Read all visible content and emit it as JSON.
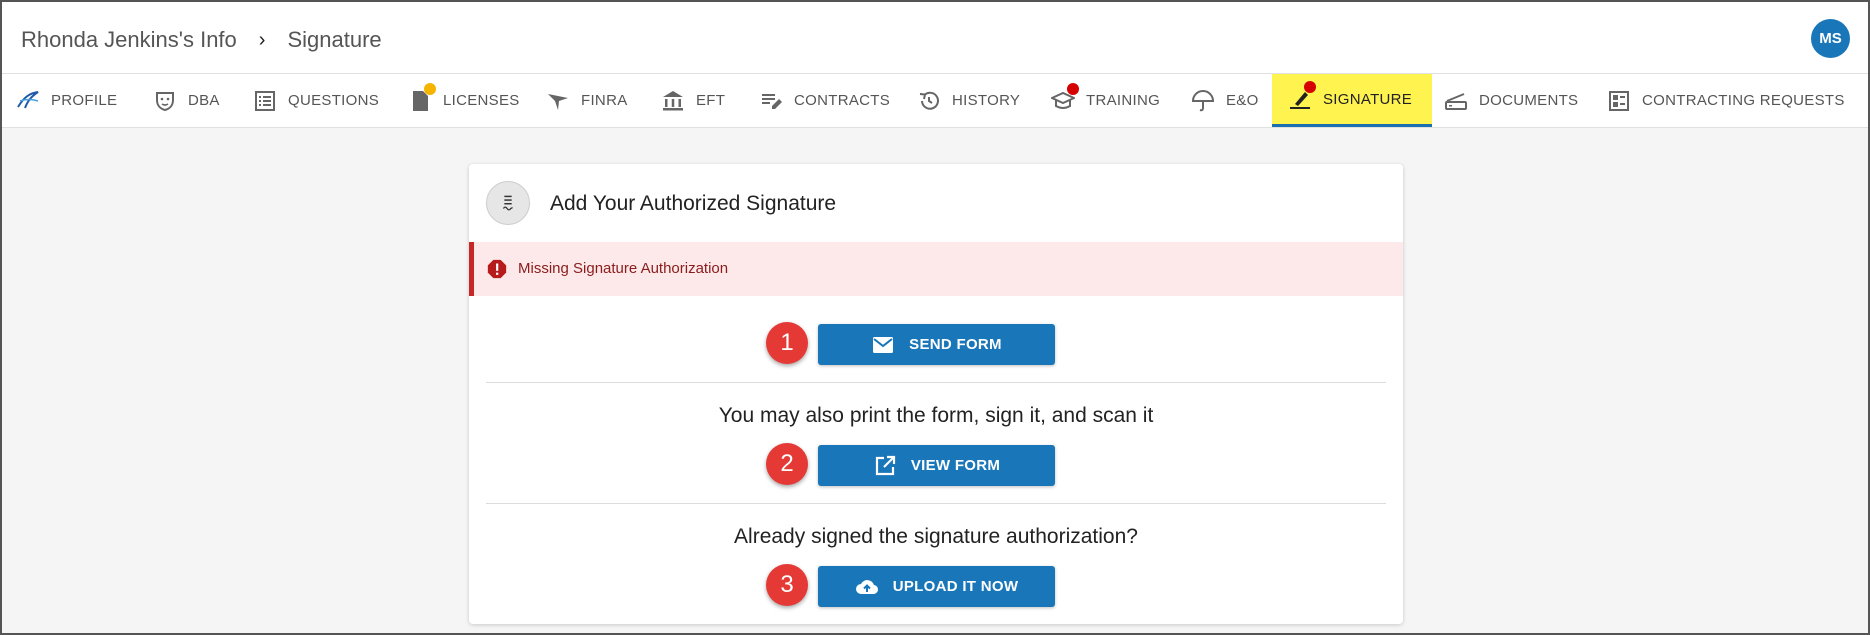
{
  "breadcrumb": {
    "parent": "Rhonda Jenkins's Info",
    "current": "Signature"
  },
  "user": {
    "initials": "MS"
  },
  "tabs": [
    {
      "label": "PROFILE",
      "icon": "profile-logo-icon"
    },
    {
      "label": "DBA",
      "icon": "masks-icon"
    },
    {
      "label": "QUESTIONS",
      "icon": "list-icon"
    },
    {
      "label": "LICENSES",
      "icon": "document-icon",
      "dot": "#f5b400"
    },
    {
      "label": "FINRA",
      "icon": "finra-icon"
    },
    {
      "label": "EFT",
      "icon": "bank-icon"
    },
    {
      "label": "CONTRACTS",
      "icon": "edit-note-icon"
    },
    {
      "label": "HISTORY",
      "icon": "history-icon"
    },
    {
      "label": "TRAINING",
      "icon": "graduation-cap-icon",
      "dot": "#d50000"
    },
    {
      "label": "E&O",
      "icon": "umbrella-icon"
    },
    {
      "label": "SIGNATURE",
      "icon": "signature-pen-icon",
      "dot": "#d50000",
      "active": true
    },
    {
      "label": "DOCUMENTS",
      "icon": "tray-icon"
    },
    {
      "label": "CONTRACTING REQUESTS",
      "icon": "dashboard-icon"
    }
  ],
  "card": {
    "title": "Add Your Authorized Signature",
    "alert": "Missing Signature Authorization",
    "steps": [
      {
        "number": "1",
        "text": "",
        "button": "SEND FORM",
        "icon": "mail-icon"
      },
      {
        "number": "2",
        "text": "You may also print the form, sign it, and scan it",
        "button": "VIEW FORM",
        "icon": "open-in-new-icon"
      },
      {
        "number": "3",
        "text": "Already signed the signature authorization?",
        "button": "UPLOAD IT NOW",
        "icon": "cloud-upload-icon"
      }
    ]
  },
  "colors": {
    "accent": "#1976b8",
    "active_tab": "#fff34f",
    "alert_bg": "#fde9e9",
    "alert_border": "#c62828",
    "badge": "#e53935"
  }
}
